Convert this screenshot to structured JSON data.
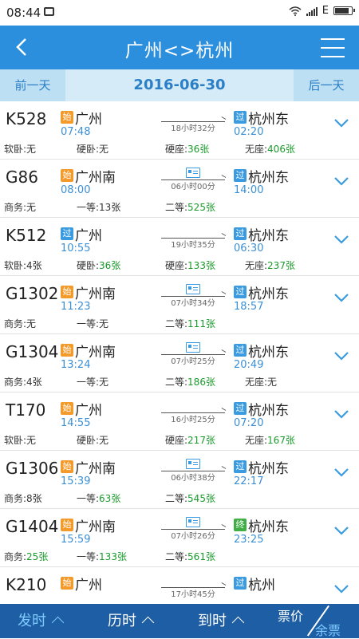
{
  "status": {
    "time": "08:44",
    "net": "E"
  },
  "header": {
    "title": "广州<>杭州"
  },
  "datebar": {
    "prev": "前一天",
    "date": "2016-06-30",
    "next": "后一天"
  },
  "trains": [
    {
      "num": "K528",
      "dep_badge": "始",
      "dep_type": "start",
      "from": "广州",
      "dep_time": "07:48",
      "duration": "18小时32分",
      "has_ticket_icon": false,
      "arr_badge": "过",
      "arr_type": "pass",
      "to": "杭州东",
      "arr_time": "02:20",
      "seats": [
        {
          "k": "软卧:",
          "v": "无",
          "g": false
        },
        {
          "k": "硬卧:",
          "v": "无",
          "g": false
        },
        {
          "k": "硬座:",
          "v": "36张",
          "g": true
        },
        {
          "k": "无座:",
          "v": "406张",
          "g": true
        }
      ]
    },
    {
      "num": "G86",
      "dep_badge": "始",
      "dep_type": "start",
      "from": "广州南",
      "dep_time": "08:00",
      "duration": "06小时00分",
      "has_ticket_icon": true,
      "arr_badge": "过",
      "arr_type": "pass",
      "to": "杭州东",
      "arr_time": "14:00",
      "seats": [
        {
          "k": "商务:",
          "v": "无",
          "g": false
        },
        {
          "k": "一等:",
          "v": "13张",
          "g": false
        },
        {
          "k": "二等:",
          "v": "525张",
          "g": true
        },
        {
          "k": "",
          "v": "",
          "g": false
        }
      ]
    },
    {
      "num": "K512",
      "dep_badge": "过",
      "dep_type": "pass",
      "from": "广州",
      "dep_time": "10:55",
      "duration": "19小时35分",
      "has_ticket_icon": false,
      "arr_badge": "过",
      "arr_type": "pass",
      "to": "杭州东",
      "arr_time": "06:30",
      "seats": [
        {
          "k": "软卧:",
          "v": "4张",
          "g": false
        },
        {
          "k": "硬卧:",
          "v": "36张",
          "g": true
        },
        {
          "k": "硬座:",
          "v": "133张",
          "g": true
        },
        {
          "k": "无座:",
          "v": "237张",
          "g": true
        }
      ]
    },
    {
      "num": "G1302",
      "dep_badge": "始",
      "dep_type": "start",
      "from": "广州南",
      "dep_time": "11:23",
      "duration": "07小时34分",
      "has_ticket_icon": true,
      "arr_badge": "过",
      "arr_type": "pass",
      "to": "杭州东",
      "arr_time": "18:57",
      "seats": [
        {
          "k": "商务:",
          "v": "无",
          "g": false
        },
        {
          "k": "一等:",
          "v": "无",
          "g": false
        },
        {
          "k": "二等:",
          "v": "111张",
          "g": true
        },
        {
          "k": "",
          "v": "",
          "g": false
        }
      ]
    },
    {
      "num": "G1304",
      "dep_badge": "始",
      "dep_type": "start",
      "from": "广州南",
      "dep_time": "13:24",
      "duration": "07小时25分",
      "has_ticket_icon": true,
      "arr_badge": "过",
      "arr_type": "pass",
      "to": "杭州东",
      "arr_time": "20:49",
      "seats": [
        {
          "k": "商务:",
          "v": "4张",
          "g": false
        },
        {
          "k": "一等:",
          "v": "无",
          "g": false
        },
        {
          "k": "二等:",
          "v": "186张",
          "g": true
        },
        {
          "k": "无座:",
          "v": "无",
          "g": false
        }
      ]
    },
    {
      "num": "T170",
      "dep_badge": "始",
      "dep_type": "start",
      "from": "广州",
      "dep_time": "14:55",
      "duration": "16小时25分",
      "has_ticket_icon": false,
      "arr_badge": "过",
      "arr_type": "pass",
      "to": "杭州东",
      "arr_time": "07:20",
      "seats": [
        {
          "k": "软卧:",
          "v": "无",
          "g": false
        },
        {
          "k": "硬卧:",
          "v": "无",
          "g": false
        },
        {
          "k": "硬座:",
          "v": "217张",
          "g": true
        },
        {
          "k": "无座:",
          "v": "167张",
          "g": true
        }
      ]
    },
    {
      "num": "G1306",
      "dep_badge": "始",
      "dep_type": "start",
      "from": "广州南",
      "dep_time": "15:39",
      "duration": "06小时38分",
      "has_ticket_icon": true,
      "arr_badge": "过",
      "arr_type": "pass",
      "to": "杭州东",
      "arr_time": "22:17",
      "seats": [
        {
          "k": "商务:",
          "v": "8张",
          "g": false
        },
        {
          "k": "一等:",
          "v": "63张",
          "g": true
        },
        {
          "k": "二等:",
          "v": "545张",
          "g": true
        },
        {
          "k": "",
          "v": "",
          "g": false
        }
      ]
    },
    {
      "num": "G1404",
      "dep_badge": "始",
      "dep_type": "start",
      "from": "广州南",
      "dep_time": "15:59",
      "duration": "07小时26分",
      "has_ticket_icon": true,
      "arr_badge": "终",
      "arr_type": "end",
      "to": "杭州东",
      "arr_time": "23:25",
      "seats": [
        {
          "k": "商务:",
          "v": "25张",
          "g": true
        },
        {
          "k": "一等:",
          "v": "133张",
          "g": true
        },
        {
          "k": "二等:",
          "v": "561张",
          "g": true
        },
        {
          "k": "",
          "v": "",
          "g": false
        }
      ]
    },
    {
      "num": "K210",
      "dep_badge": "始",
      "dep_type": "start",
      "from": "广州",
      "dep_time": "",
      "duration": "17小时45分",
      "has_ticket_icon": false,
      "arr_badge": "过",
      "arr_type": "pass",
      "to": "杭州",
      "arr_time": "",
      "seats": [
        {
          "k": "",
          "v": "",
          "g": false
        },
        {
          "k": "",
          "v": "",
          "g": false
        },
        {
          "k": "",
          "v": "",
          "g": false
        },
        {
          "k": "",
          "v": "",
          "g": false
        }
      ]
    }
  ],
  "bottom": {
    "tab1": "发时",
    "tab2": "历时",
    "tab3": "到时",
    "price1": "票价",
    "price2": "余票"
  },
  "colors": {
    "header": "#2b8fdd",
    "bottom": "#1e5ea4",
    "start_badge": "#f39a2b",
    "pass_badge": "#3a9be0",
    "end_badge": "#3fae45",
    "available": "#1a9b2c"
  }
}
